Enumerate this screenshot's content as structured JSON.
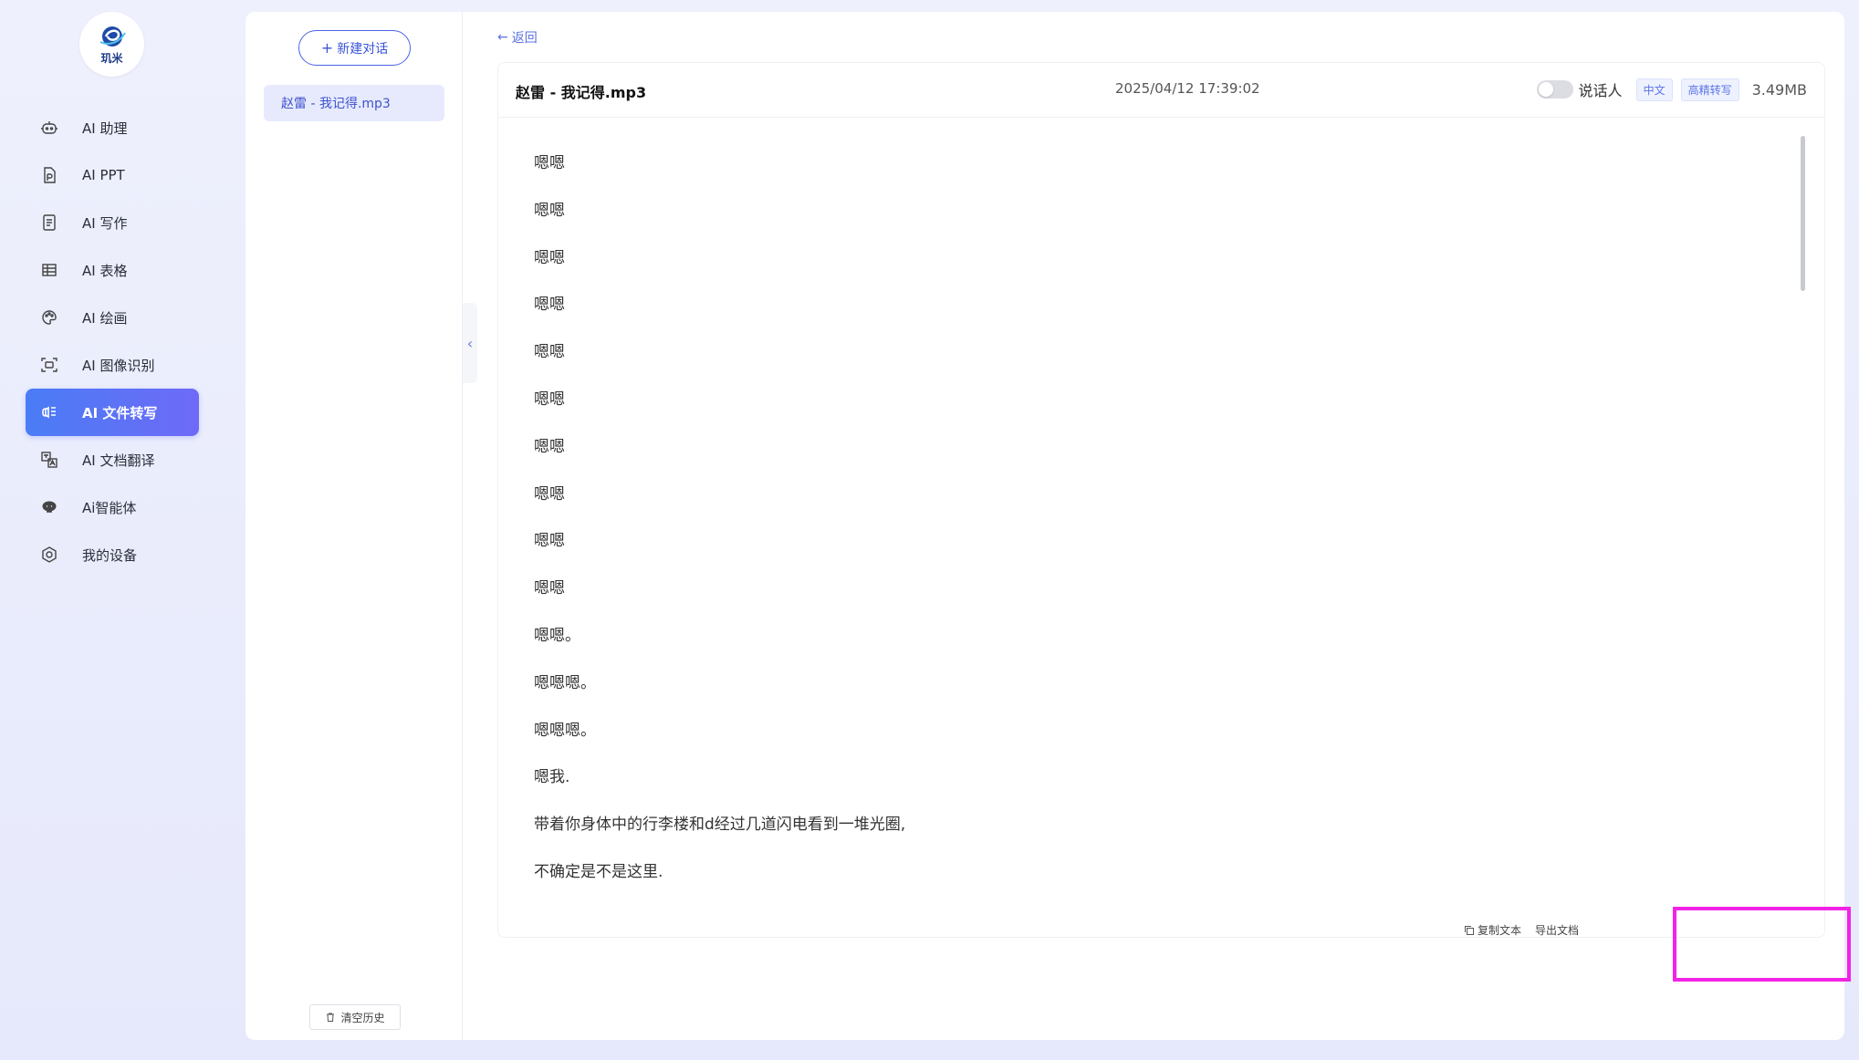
{
  "logo": {
    "text": "玑米",
    "icon": "logo-mark"
  },
  "nav": {
    "items": [
      {
        "label": "AI 助理",
        "icon": "robot-icon"
      },
      {
        "label": "AI PPT",
        "icon": "ppt-file-icon"
      },
      {
        "label": "AI 写作",
        "icon": "document-icon"
      },
      {
        "label": "AI 表格",
        "icon": "table-icon"
      },
      {
        "label": "AI 绘画",
        "icon": "palette-icon"
      },
      {
        "label": "AI 图像识别",
        "icon": "scan-image-icon"
      },
      {
        "label": "AI 文件转写",
        "icon": "transcribe-icon",
        "active": true
      },
      {
        "label": "AI 文档翻译",
        "icon": "translate-icon"
      },
      {
        "label": "Ai智能体",
        "icon": "agent-icon"
      },
      {
        "label": "我的设备",
        "icon": "device-icon"
      }
    ]
  },
  "sidebar": {
    "new_chat_label": "新建对话",
    "history": [
      "赵雷 - 我记得.mp3"
    ],
    "clear_label": "清空历史"
  },
  "main": {
    "back_label": "返回",
    "file": {
      "name": "赵雷 - 我记得.mp3",
      "date": "2025/04/12 17:39:02",
      "speaker_label": "说话人",
      "speaker_toggle_on": false,
      "tags": [
        "中文",
        "高精转写"
      ],
      "size": "3.49MB"
    },
    "transcript": [
      "嗯嗯",
      "嗯嗯",
      "嗯嗯",
      "嗯嗯",
      "嗯嗯",
      "嗯嗯",
      "嗯嗯",
      "嗯嗯",
      "嗯嗯",
      "嗯嗯",
      "嗯嗯。",
      "嗯嗯嗯。",
      "嗯嗯嗯。",
      "嗯我.",
      "带着你身体中的行李楼和d经过几道闪电看到一堆光圈,",
      "不确定是不是这里."
    ],
    "actions": {
      "copy_label": "复制文本",
      "export_label": "导出文档"
    }
  },
  "colors": {
    "accent": "#4a64e8",
    "active_nav_start": "#4a7cf5",
    "active_nav_end": "#6e6af7",
    "highlight": "#f222e6"
  }
}
